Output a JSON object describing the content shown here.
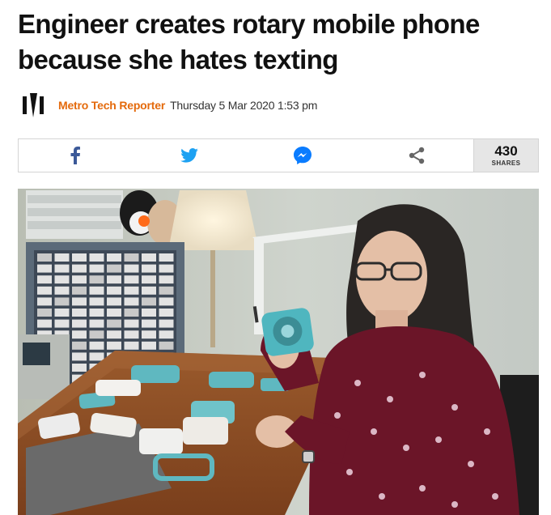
{
  "article": {
    "headline": "Engineer creates rotary mobile phone because she hates texting"
  },
  "byline": {
    "author": "Metro Tech Reporter",
    "date": "Thursday 5 Mar 2020 1:53 pm"
  },
  "share": {
    "buttons": [
      {
        "name": "facebook-share-button",
        "icon": "facebook-icon",
        "color": "#3b5998"
      },
      {
        "name": "twitter-share-button",
        "icon": "twitter-icon",
        "color": "#1da1f2"
      },
      {
        "name": "messenger-share-button",
        "icon": "messenger-icon",
        "color": "#0a7cff"
      },
      {
        "name": "share-button",
        "icon": "share-icon",
        "color": "#666666"
      }
    ],
    "count": "430",
    "count_label": "SHARES"
  },
  "photo": {
    "subject": "woman holding a teal rotary mobile phone at a workbench with phone parts"
  }
}
